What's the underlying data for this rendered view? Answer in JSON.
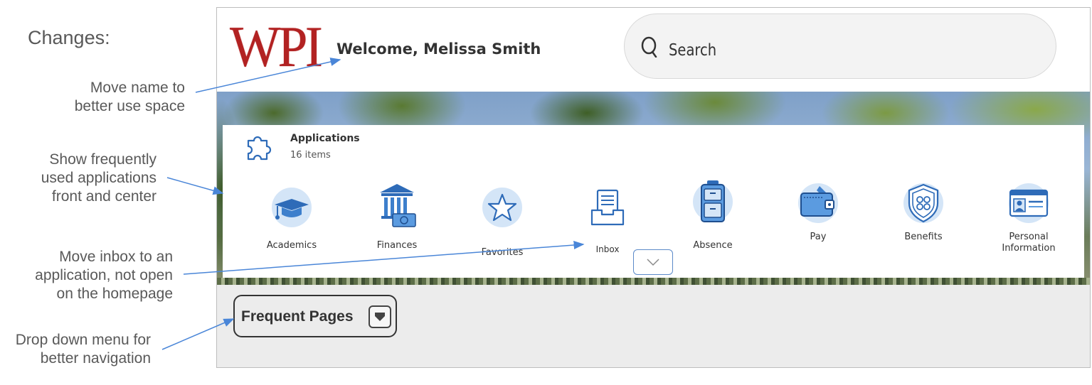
{
  "annotations": {
    "title": "Changes:",
    "name_note": "Move name to\nbetter use space",
    "apps_note": "Show frequently\nused applications\nfront and center",
    "inbox_note": "Move inbox to an\napplication, not open\non the homepage",
    "dropdown_note": "Drop down menu for\nbetter navigation"
  },
  "header": {
    "logo_text": "WPI",
    "welcome": "Welcome, Melissa Smith",
    "search_placeholder": "Search"
  },
  "applications": {
    "title": "Applications",
    "count": "16 items",
    "items": [
      {
        "label": "Academics",
        "icon": "graduation-cap-icon"
      },
      {
        "label": "Finances",
        "icon": "bank-icon"
      },
      {
        "label": "Favorites",
        "icon": "star-icon"
      },
      {
        "label": "Inbox",
        "icon": "inbox-icon"
      },
      {
        "label": "Absence",
        "icon": "suitcase-icon"
      },
      {
        "label": "Pay",
        "icon": "wallet-icon"
      },
      {
        "label": "Benefits",
        "icon": "shield-icon"
      },
      {
        "label": "Personal Information",
        "icon": "id-card-icon"
      }
    ]
  },
  "frequent_pages": {
    "label": "Frequent Pages"
  },
  "colors": {
    "brand_red": "#b22222",
    "icon_blue": "#2e6bb8",
    "icon_circle": "#d4e5f7",
    "annotation_arrow": "#4a86d8"
  }
}
